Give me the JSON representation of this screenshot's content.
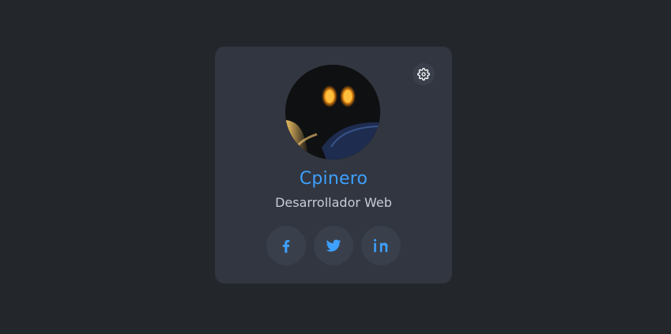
{
  "profile": {
    "name": "Cpinero",
    "role": "Desarrollador Web",
    "avatar_icon": "avatar-icon"
  },
  "settings": {
    "icon": "gear-icon",
    "label": "Settings"
  },
  "social": {
    "items": [
      {
        "name": "facebook",
        "icon": "facebook-icon"
      },
      {
        "name": "twitter",
        "icon": "twitter-icon"
      },
      {
        "name": "linkedin",
        "icon": "linkedin-icon"
      }
    ]
  },
  "colors": {
    "background": "#23262b",
    "card": "#313640",
    "accent": "#3ea0ff",
    "text": "#c7ccd5",
    "button_bg": "#3a404b"
  }
}
